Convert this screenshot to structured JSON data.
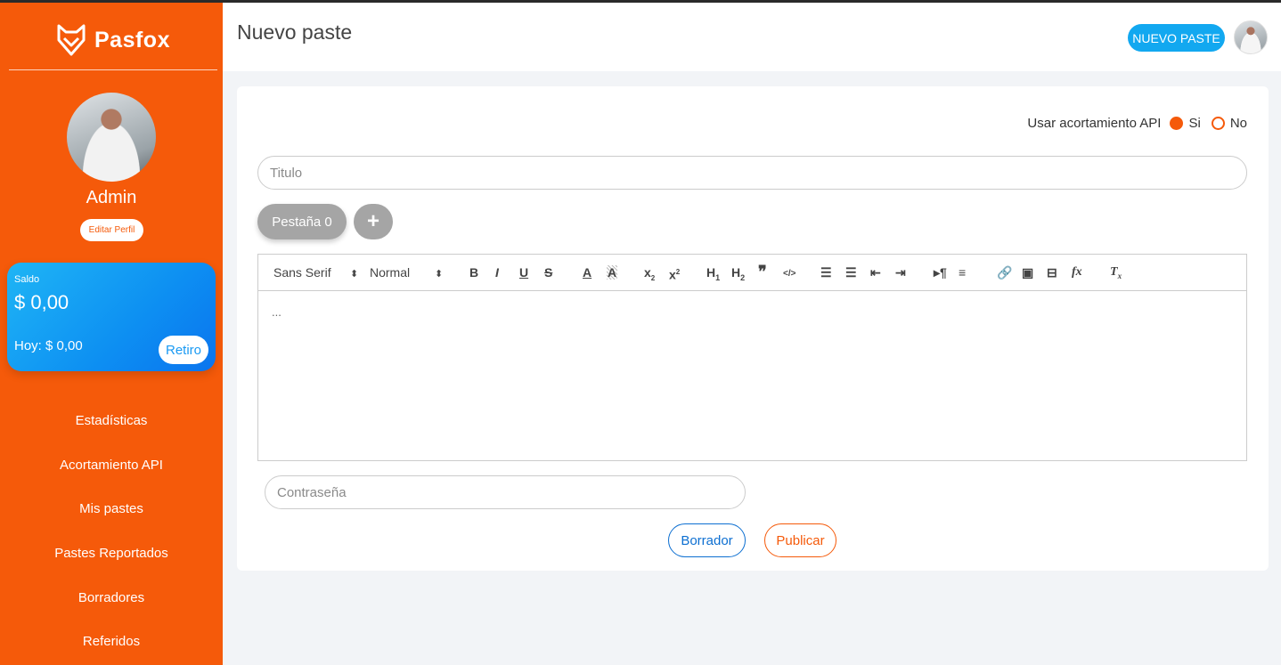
{
  "brand": {
    "name": "Pasfox",
    "logo_icon": "fox-logo-icon"
  },
  "profile": {
    "name": "Admin",
    "edit_label": "Editar Perfil"
  },
  "balance": {
    "label": "Saldo",
    "amount": "$ 0,00",
    "today": "Hoy: $ 0,00",
    "withdraw_label": "Retiro"
  },
  "nav": {
    "items": [
      {
        "label": "Estadísticas"
      },
      {
        "label": "Acortamiento API"
      },
      {
        "label": "Mis pastes"
      },
      {
        "label": "Pastes Reportados"
      },
      {
        "label": "Borradores"
      },
      {
        "label": "Referidos"
      }
    ]
  },
  "header": {
    "title": "Nuevo paste",
    "new_paste_label": "NUEVO PASTE"
  },
  "form": {
    "api_label": "Usar acortamiento API",
    "api_options": [
      {
        "label": "Si",
        "selected": true
      },
      {
        "label": "No",
        "selected": false
      }
    ],
    "title_placeholder": "Titulo",
    "tab_label": "Pestaña 0",
    "add_tab_label": "+",
    "editor": {
      "font_family": "Sans Serif",
      "font_size": "Normal",
      "content": "...",
      "toolbar_icons": [
        "bold-icon",
        "italic-icon",
        "underline-icon",
        "strike-icon",
        "text-color-icon",
        "background-color-icon",
        "subscript-icon",
        "superscript-icon",
        "header1-icon",
        "header2-icon",
        "blockquote-icon",
        "code-block-icon",
        "ordered-list-icon",
        "bullet-list-icon",
        "outdent-icon",
        "indent-icon",
        "text-direction-icon",
        "align-icon",
        "link-icon",
        "image-icon",
        "video-icon",
        "formula-icon",
        "clear-format-icon"
      ]
    },
    "password_placeholder": "Contraseña",
    "draft_label": "Borrador",
    "publish_label": "Publicar"
  },
  "colors": {
    "sidebar": "#f55a0a",
    "accent_blue": "#12a8f0",
    "draft_blue": "#0d6fd1"
  }
}
